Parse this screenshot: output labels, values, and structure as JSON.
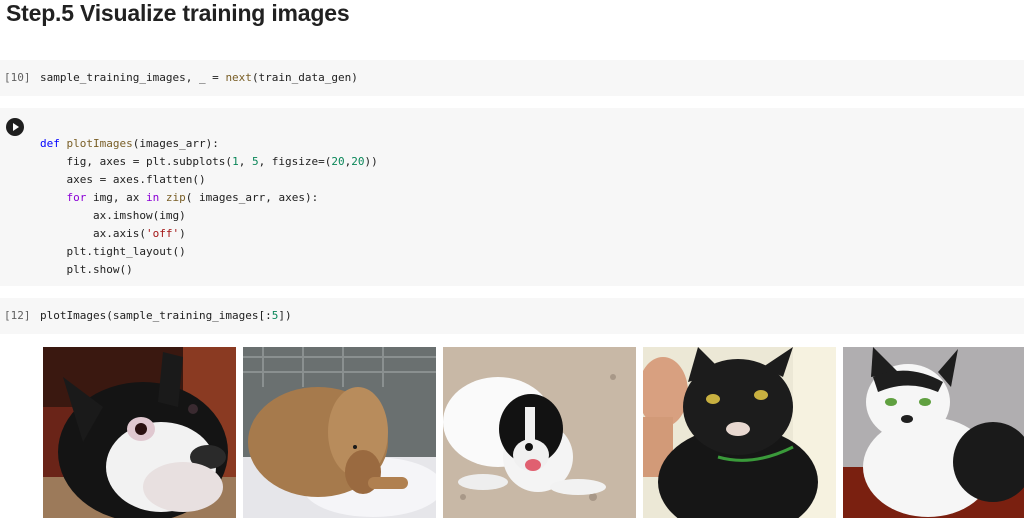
{
  "heading": "Step.5 Visualize training images",
  "cells": {
    "c10": {
      "exec_count": "[10]",
      "line": [
        {
          "t": "sample_training_images, _ = ",
          "c": ""
        },
        {
          "t": "next",
          "c": "fn"
        },
        {
          "t": "(train_data_gen)",
          "c": ""
        }
      ]
    },
    "run": {
      "lines": [
        [
          {
            "t": "def ",
            "c": "def"
          },
          {
            "t": "plotImages",
            "c": "fn"
          },
          {
            "t": "(images_arr):",
            "c": ""
          }
        ],
        [
          {
            "t": "    fig, axes = plt.subplots(",
            "c": ""
          },
          {
            "t": "1",
            "c": "num"
          },
          {
            "t": ", ",
            "c": ""
          },
          {
            "t": "5",
            "c": "num"
          },
          {
            "t": ", figsize=(",
            "c": ""
          },
          {
            "t": "20",
            "c": "num"
          },
          {
            "t": ",",
            "c": ""
          },
          {
            "t": "20",
            "c": "num"
          },
          {
            "t": "))",
            "c": ""
          }
        ],
        [
          {
            "t": "    axes = axes.flatten()",
            "c": ""
          }
        ],
        [
          {
            "t": "    ",
            "c": ""
          },
          {
            "t": "for",
            "c": "kw"
          },
          {
            "t": " img, ax ",
            "c": ""
          },
          {
            "t": "in",
            "c": "kw"
          },
          {
            "t": " ",
            "c": ""
          },
          {
            "t": "zip",
            "c": "fn"
          },
          {
            "t": "( images_arr, axes):",
            "c": ""
          }
        ],
        [
          {
            "t": "        ax.imshow(img)",
            "c": ""
          }
        ],
        [
          {
            "t": "        ax.axis(",
            "c": ""
          },
          {
            "t": "'off'",
            "c": "str"
          },
          {
            "t": ")",
            "c": ""
          }
        ],
        [
          {
            "t": "    plt.tight_layout()",
            "c": ""
          }
        ],
        [
          {
            "t": "    plt.show()",
            "c": ""
          }
        ]
      ]
    },
    "c12": {
      "exec_count": "[12]",
      "line": [
        {
          "t": "plotImages(sample_training_images[:",
          "c": ""
        },
        {
          "t": "5",
          "c": "num"
        },
        {
          "t": "])",
          "c": ""
        }
      ]
    }
  },
  "output_images": [
    {
      "subject": "boston-terrier-dog"
    },
    {
      "subject": "brown-dog-lying-on-blanket"
    },
    {
      "subject": "white-dog-with-black-head-on-sand"
    },
    {
      "subject": "black-cat-held-by-hand"
    },
    {
      "subject": "black-and-white-kitten"
    }
  ],
  "colors": {
    "cell_bg": "#f7f7f7",
    "keyword": "#8b00d6",
    "function": "#795e26",
    "number": "#098658",
    "string": "#a31515"
  }
}
